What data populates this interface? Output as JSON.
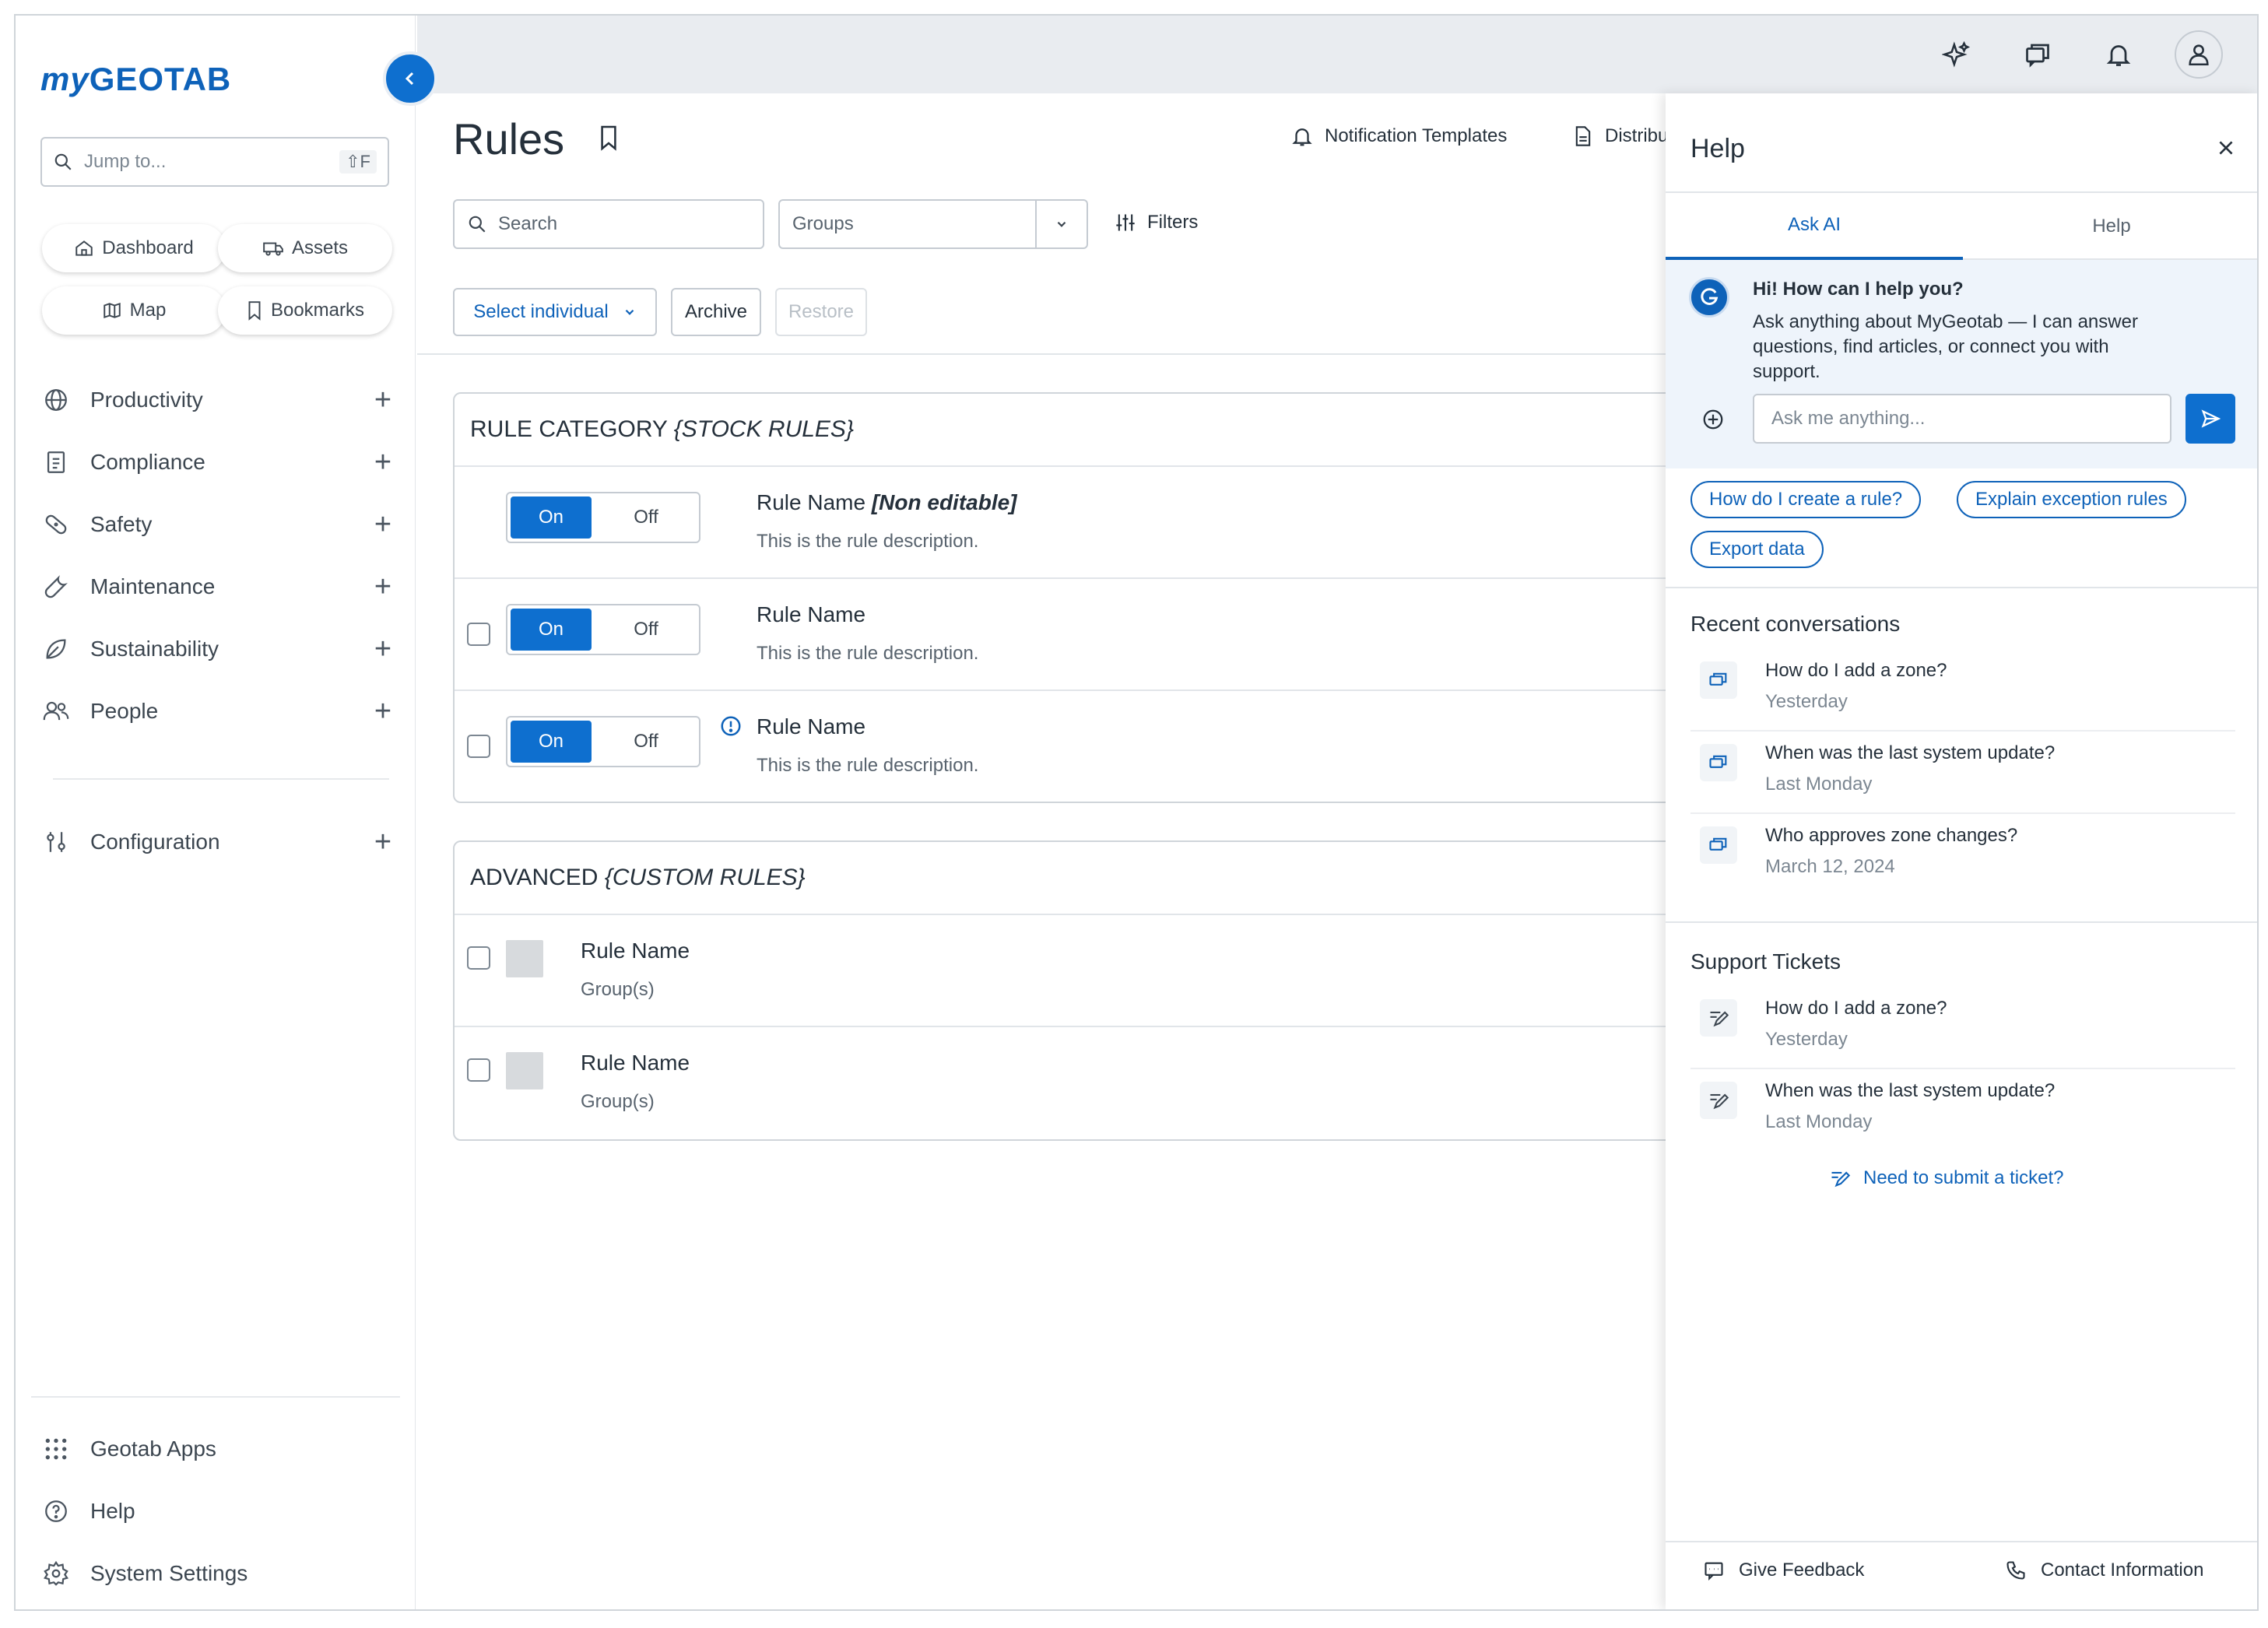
{
  "app": {
    "logo_my": "my",
    "logo_rest": "GEOTAB"
  },
  "sidebar": {
    "jump_placeholder": "Jump to...",
    "jump_shortcut": "⇧F",
    "quick": [
      "Dashboard",
      "Assets",
      "Map",
      "Bookmarks"
    ],
    "items": [
      "Productivity",
      "Compliance",
      "Safety",
      "Maintenance",
      "Sustainability",
      "People"
    ],
    "config": "Configuration",
    "bottom": [
      "Geotab Apps",
      "Help",
      "System Settings"
    ]
  },
  "main": {
    "title": "Rules",
    "notification_templates": "Notification Templates",
    "distribution": "Distribu",
    "search_placeholder": "Search",
    "groups_placeholder": "Groups",
    "filters": "Filters",
    "select_individual": "Select individual",
    "archive": "Archive",
    "restore": "Restore",
    "stock_card": {
      "title_plain": "RULE CATEGORY ",
      "title_italic": "{STOCK RULES}",
      "rows": [
        {
          "name": "Rule Name ",
          "tag": "[Non editable]",
          "desc": "This is the rule description.",
          "on": "On",
          "off": "Off"
        },
        {
          "name": "Rule Name",
          "tag": "",
          "desc": "This is the rule description.",
          "on": "On",
          "off": "Off"
        },
        {
          "name": "Rule Name",
          "tag": "",
          "desc": "This is the rule description.",
          "on": "On",
          "off": "Off"
        }
      ]
    },
    "custom_card": {
      "title_plain": "ADVANCED ",
      "title_italic": "{CUSTOM RULES}",
      "rows": [
        {
          "name": "Rule Name",
          "sub": "Group(s)"
        },
        {
          "name": "Rule Name",
          "sub": "Group(s)"
        }
      ]
    }
  },
  "help": {
    "title": "Help",
    "tabs": [
      "Ask AI",
      "Help"
    ],
    "greeting": "Hi! How can I help you?",
    "intro_1": "Ask anything about MyGeotab — I can answer",
    "intro_2": "questions, find articles, or connect you with",
    "intro_3": "support.",
    "ask_placeholder": "Ask me anything...",
    "chips": [
      "How do I create a rule?",
      "Explain exception rules",
      "Export data"
    ],
    "recent_title": "Recent conversations",
    "recent": [
      {
        "q": "How do I add a zone?",
        "d": "Yesterday"
      },
      {
        "q": "When was the last system update?",
        "d": "Last Monday"
      },
      {
        "q": "Who approves zone changes?",
        "d": "March 12, 2024"
      }
    ],
    "tickets_title": "Support Tickets",
    "tickets": [
      {
        "q": "How do I add a zone?",
        "d": "Yesterday"
      },
      {
        "q": "When was the last system update?",
        "d": "Last Monday"
      }
    ],
    "submit_ticket": "Need to submit a ticket?",
    "feedback": "Give Feedback",
    "contact": "Contact Information"
  },
  "colors": {
    "brand": "#0e62b9",
    "accent": "#0e6fcf",
    "topbar": "#e9ecf0",
    "ai_background": "#eef4fb"
  }
}
